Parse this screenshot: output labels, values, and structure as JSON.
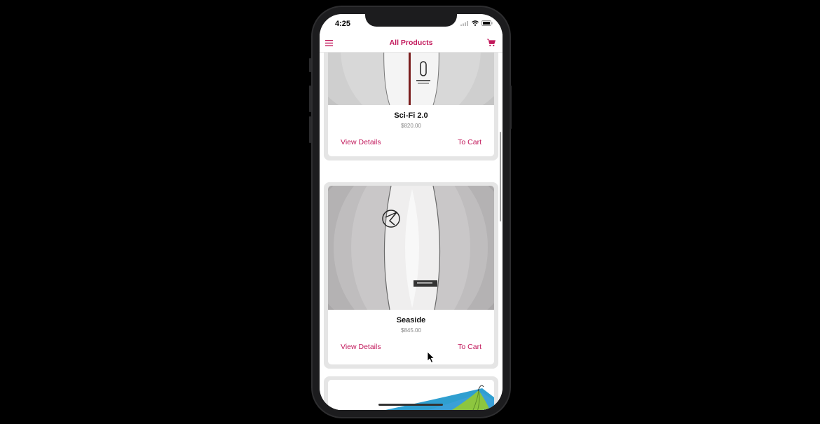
{
  "status_bar": {
    "time": "4:25"
  },
  "navbar": {
    "title": "All Products",
    "menu_icon": "hamburger-menu-icon",
    "cart_icon": "shopping-cart-icon"
  },
  "accent_color": "#c2185b",
  "products": [
    {
      "name": "Sci-Fi 2.0",
      "price": "$820.00",
      "view_label": "View Details",
      "cart_label": "To Cart"
    },
    {
      "name": "Seaside",
      "price": "$845.00",
      "view_label": "View Details",
      "cart_label": "To Cart"
    },
    {
      "name": "",
      "price": "",
      "view_label": "",
      "cart_label": ""
    }
  ]
}
